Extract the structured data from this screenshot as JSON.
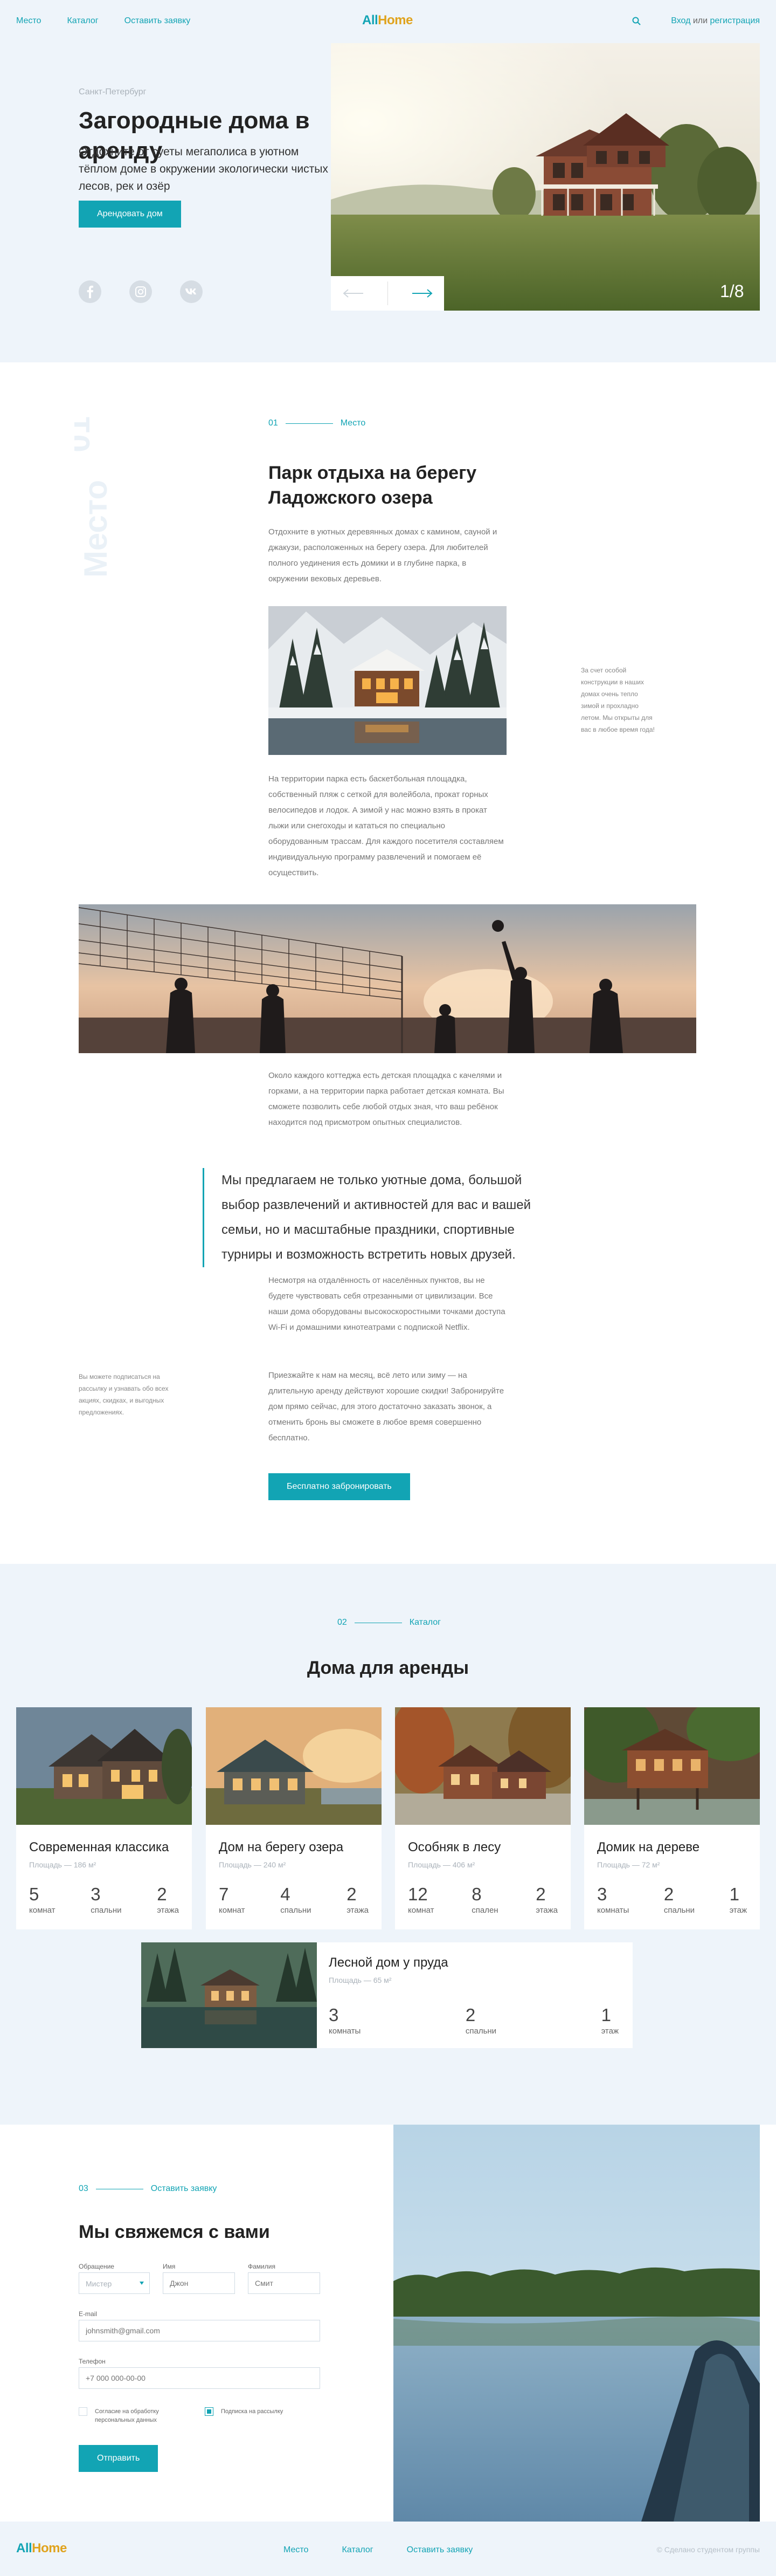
{
  "header": {
    "nav": [
      "Место",
      "Каталог",
      "Оставить заявку"
    ],
    "logo_a": "All",
    "logo_b": "Home",
    "login": "Вход",
    "or": "или",
    "register": "регистрация"
  },
  "hero": {
    "city": "Санкт-Петербург",
    "title": "Загородные дома в аренду",
    "lead": "Отдохните от суеты мегаполиса в уютном тёплом доме в окружении экологически чистых лесов, рек и озёр",
    "cta": "Арендовать дом",
    "slide_counter": "1/8",
    "socials": [
      "facebook-icon",
      "instagram-icon",
      "vk-icon"
    ]
  },
  "about": {
    "vertical_num": "01",
    "vertical_word": "Место",
    "eyebrow_num": "01",
    "eyebrow_label": "Место",
    "title": "Парк отдыха на берегу Ладожского озера",
    "p1": "Отдохните в уютных деревянных домах с камином, сауной и джакузи, расположенных на берегу озера. Для любителей полного уединения есть домики и в глубине парка, в окружении вековых деревьев.",
    "note1": "За счет особой конструкции в наших домах очень тепло зимой и прохладно летом. Мы открыты для вас в любое время года!",
    "p2": "На территории парка есть баскетбольная площадка, собственный пляж с сеткой для волейбола, прокат горных велосипедов и лодок. А зимой у нас можно взять в прокат лыжи или снегоходы и кататься по специально оборудованным трассам. Для каждого посетителя составляем индивидуальную программу развлечений и помогаем её осуществить.",
    "p3": "Около каждого коттеджа есть детская площадка с качелями и горками, а на территории парка работает детская комната. Вы сможете позволить себе любой отдых зная, что ваш ребёнок находится под присмотром опытных специалистов.",
    "quote": "Мы предлагаем не только уютные дома, большой выбор развлечений и активностей для вас и вашей семьи, но и масштабные праздники, спортивные турниры и возможность встретить новых друзей.",
    "p4": "Несмотря на отдалённость от населённых пунктов, вы не будете чувствовать себя отрезанными от цивилизации. Все наши дома оборудованы высокоскоростными точками доступа Wi-Fi и домашними кинотеатрами с подпиской Netflix.",
    "note2": "Вы можете подписаться на рассылку и узнавать обо всех акциях, скидках, и выгодных предложениях.",
    "p5": "Приезжайте к нам на месяц, всё лето или зиму — на длительную аренду действуют хорошие скидки! Забронируйте дом прямо сейчас, для этого достаточно заказать звонок, а отменить бронь вы сможете в любое время совершенно бесплатно.",
    "cta": "Бесплатно забронировать"
  },
  "catalog": {
    "eyebrow_num": "02",
    "eyebrow_label": "Каталог",
    "title": "Дома для аренды",
    "cards": [
      {
        "name": "Современная классика",
        "area": "Площадь — 186 м²",
        "stats": [
          {
            "n": "5",
            "l": "комнат"
          },
          {
            "n": "3",
            "l": "спальни"
          },
          {
            "n": "2",
            "l": "этажа"
          }
        ]
      },
      {
        "name": "Дом на берегу озера",
        "area": "Площадь — 240 м²",
        "stats": [
          {
            "n": "7",
            "l": "комнат"
          },
          {
            "n": "4",
            "l": "спальни"
          },
          {
            "n": "2",
            "l": "этажа"
          }
        ]
      },
      {
        "name": "Особняк в лесу",
        "area": "Площадь — 406 м²",
        "stats": [
          {
            "n": "12",
            "l": "комнат"
          },
          {
            "n": "8",
            "l": "спален"
          },
          {
            "n": "2",
            "l": "этажа"
          }
        ]
      },
      {
        "name": "Домик на дереве",
        "area": "Площадь — 72 м²",
        "stats": [
          {
            "n": "3",
            "l": "комнаты"
          },
          {
            "n": "2",
            "l": "спальни"
          },
          {
            "n": "1",
            "l": "этаж"
          }
        ]
      },
      {
        "name": "Лесной дом у пруда",
        "area": "Площадь — 65 м²",
        "stats": [
          {
            "n": "3",
            "l": "комнаты"
          },
          {
            "n": "2",
            "l": "спальни"
          },
          {
            "n": "1",
            "l": "этаж"
          }
        ]
      }
    ]
  },
  "contact": {
    "eyebrow_num": "03",
    "eyebrow_label": "Оставить заявку",
    "title": "Мы свяжемся с вами",
    "salutation_label": "Обращение",
    "salutation_value": "Мистер",
    "first_label": "Имя",
    "first_placeholder": "Джон",
    "last_label": "Фамилия",
    "last_placeholder": "Смит",
    "email_label": "E-mail",
    "email_placeholder": "johnsmith@gmail.com",
    "phone_label": "Телефон",
    "phone_placeholder": "+7 000 000-00-00",
    "consent": "Согласие на обработку персональных данных",
    "newsletter": "Подписка на рассылку",
    "submit": "Отправить"
  },
  "footer": {
    "logo_a": "All",
    "logo_b": "Home",
    "nav": [
      "Место",
      "Каталог",
      "Оставить заявку"
    ],
    "copy": "© Сделано студентом группы"
  }
}
